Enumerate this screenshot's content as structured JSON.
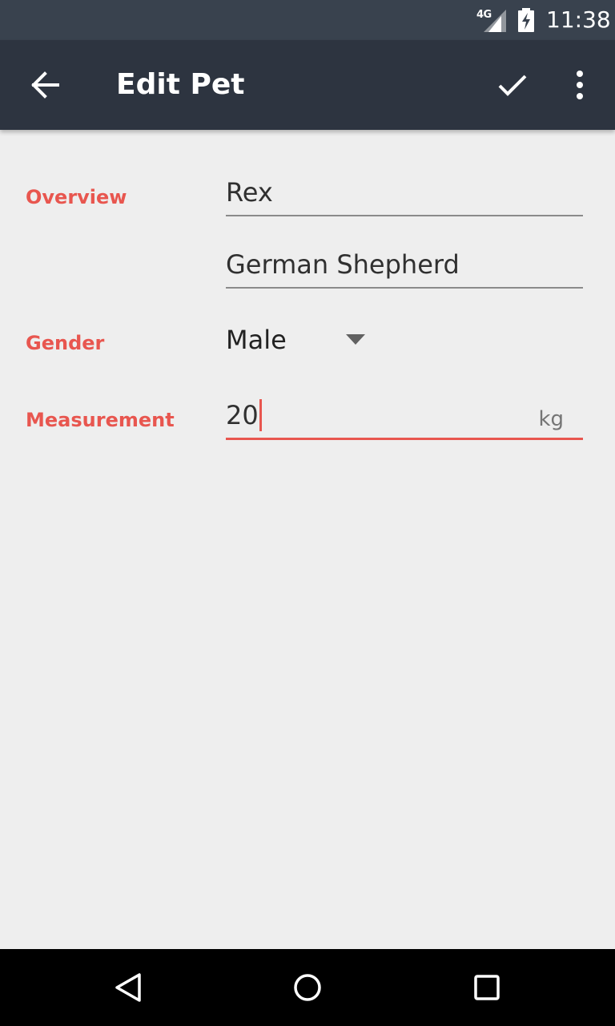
{
  "status_bar": {
    "network": "4G",
    "time": "11:38",
    "icons": [
      "signal-icon",
      "battery-charging-icon"
    ]
  },
  "toolbar": {
    "title": "Edit Pet",
    "icons": [
      "back-arrow-icon",
      "check-icon",
      "more-vert-icon"
    ]
  },
  "form": {
    "overview_label": "Overview",
    "name_value": "Rex",
    "breed_value": "German Shepherd",
    "gender_label": "Gender",
    "gender_value": "Male",
    "measurement_label": "Measurement",
    "measurement_value": "20",
    "measurement_unit": "kg"
  },
  "nav_bar": {
    "icons": [
      "back-triangle-icon",
      "home-circle-icon",
      "recents-square-icon"
    ]
  },
  "colors": {
    "accent": "#e8564f",
    "toolbar": "#2d3440",
    "status_bar": "#39424e",
    "background": "#eeeeee"
  }
}
